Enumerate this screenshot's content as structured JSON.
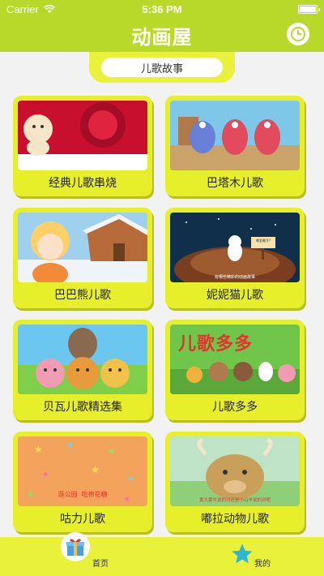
{
  "status_bar": {
    "carrier": "Carrier",
    "time": "5:36 PM"
  },
  "header": {
    "title": "动画屋"
  },
  "category": {
    "current": "儿歌故事"
  },
  "cards": [
    {
      "label": "经典儿歌串烧"
    },
    {
      "label": "巴塔木儿歌"
    },
    {
      "label": "巴巴熊儿歌"
    },
    {
      "label": "妮妮猫儿歌"
    },
    {
      "label": "贝瓦儿歌精选集"
    },
    {
      "label": "儿歌多多"
    },
    {
      "label": "咕力儿歌"
    },
    {
      "label": "嘟拉动物儿歌"
    }
  ],
  "thumb_text": {
    "card4_sign": "哪里最冷?",
    "card4_caption": "有哪些精彩的动画故事",
    "card6_title": "儿歌多多",
    "card7_caption": "逛公园  吃棉花糖",
    "card8_caption": "黄大黄牛说的对还是小山羊说的对呢"
  },
  "tabbar": {
    "items": [
      {
        "label": "首页"
      },
      {
        "label": "我的"
      }
    ]
  },
  "colors": {
    "brand": "#b9d92a",
    "card_bg": "#e6ef2a",
    "tab_bg": "#e9f13a"
  }
}
